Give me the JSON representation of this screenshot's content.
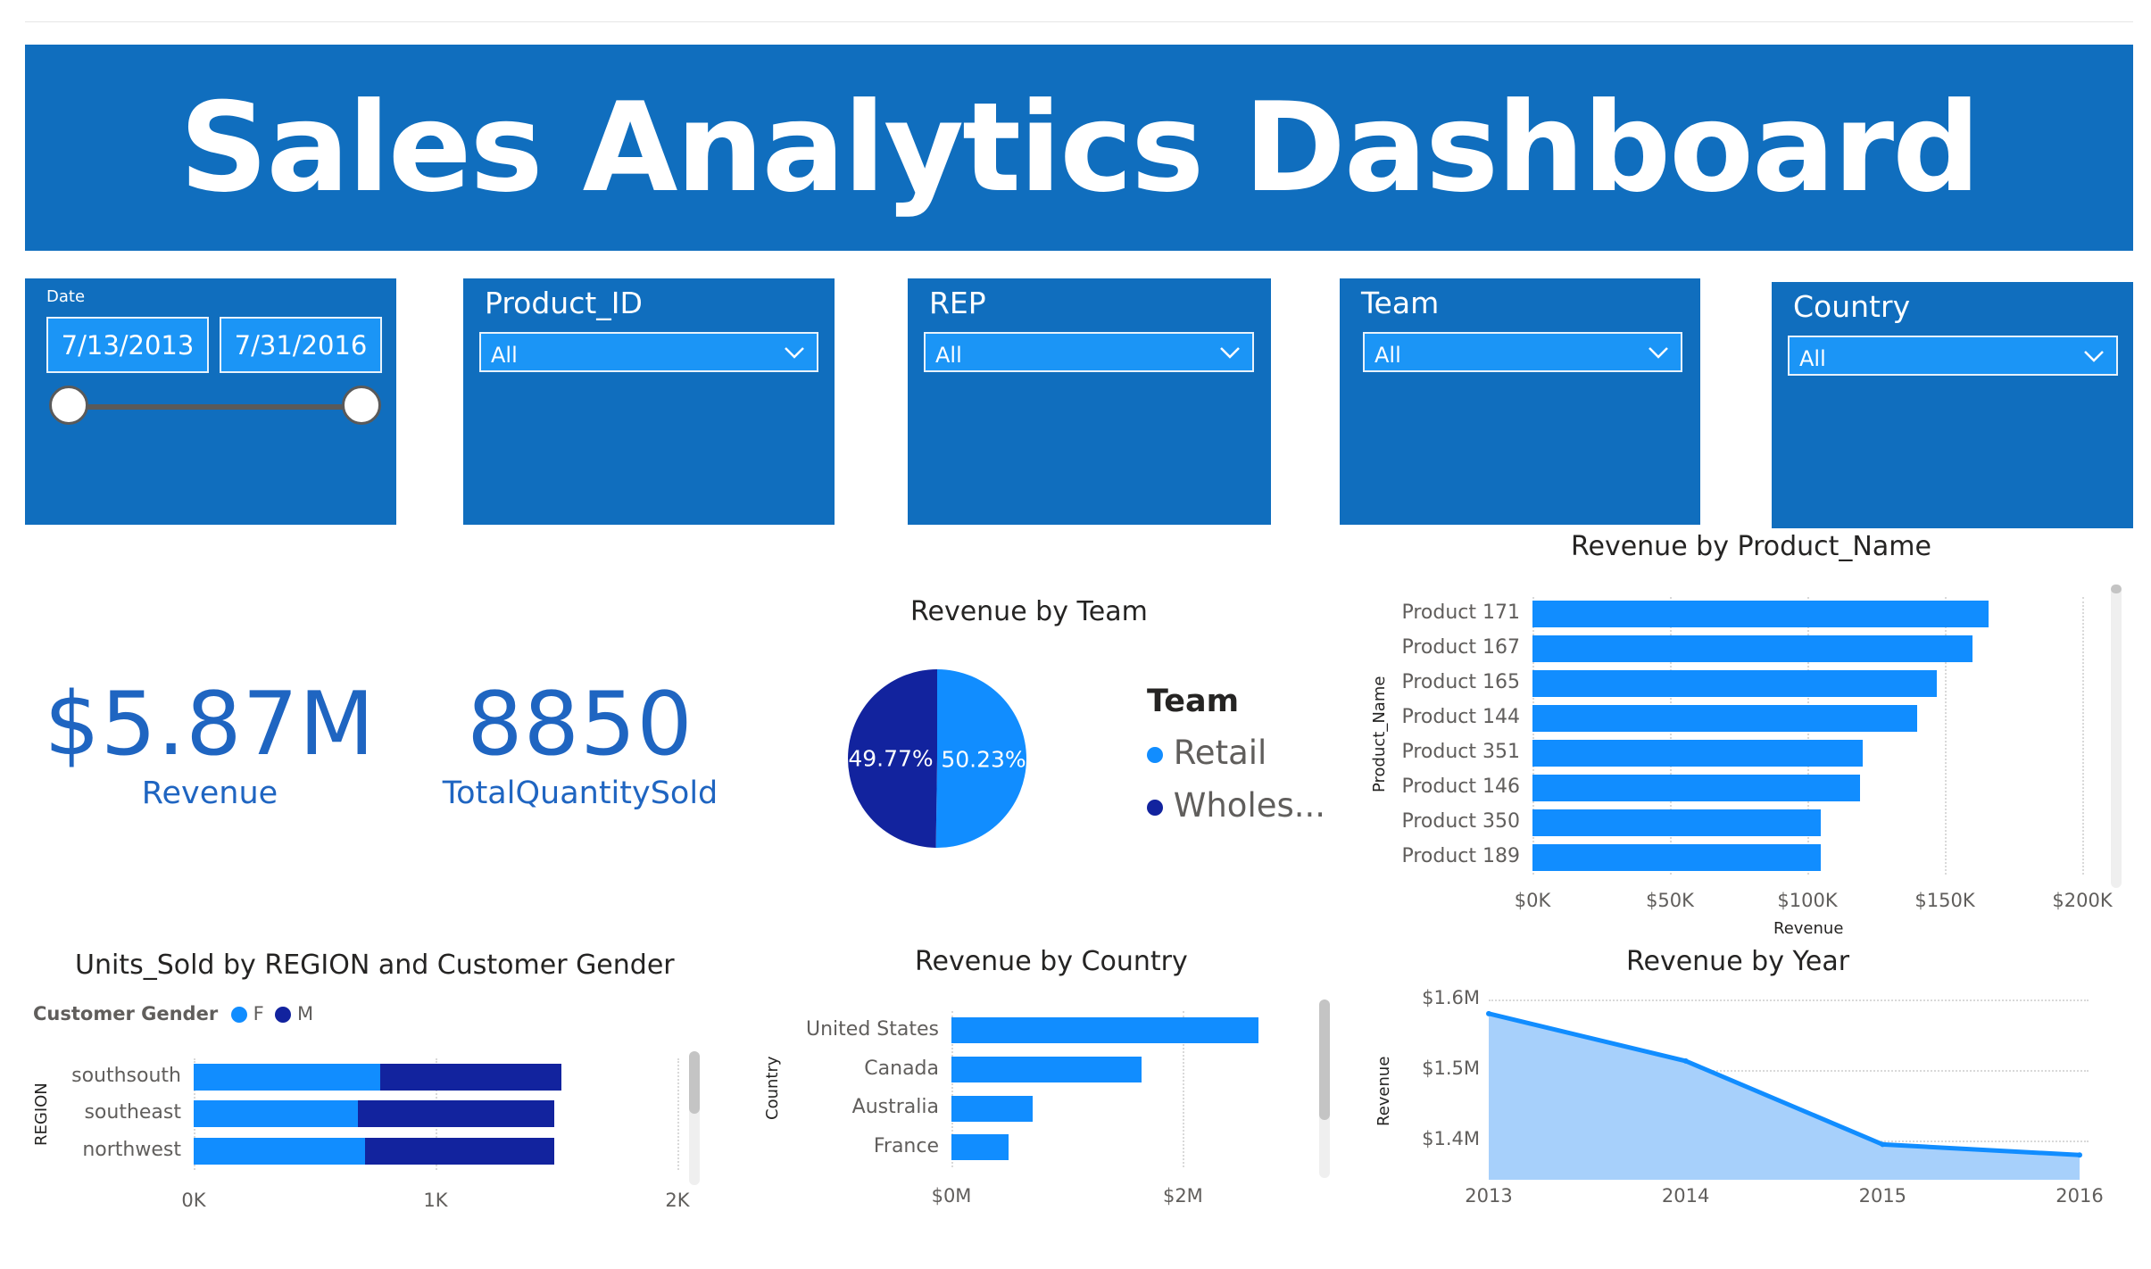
{
  "header": {
    "title": "Sales Analytics Dashboard"
  },
  "slicers": {
    "date": {
      "label": "Date",
      "start": "7/13/2013",
      "end": "7/31/2016"
    },
    "product_id": {
      "label": "Product_ID",
      "value": "All"
    },
    "rep": {
      "label": "REP",
      "value": "All"
    },
    "team": {
      "label": "Team",
      "value": "All"
    },
    "country": {
      "label": "Country",
      "value": "All"
    }
  },
  "kpis": {
    "revenue": {
      "value": "$5.87M",
      "label": "Revenue"
    },
    "quantity": {
      "value": "8850",
      "label": "TotalQuantitySold"
    }
  },
  "colors": {
    "banner": "#106ebe",
    "primary": "#118dff",
    "dark": "#12239e",
    "kpi": "#1f65c1"
  },
  "chart_data": [
    {
      "id": "revenue_by_team",
      "type": "pie",
      "title": "Revenue by Team",
      "legend_title": "Team",
      "legend_position": "right",
      "labels": [
        "Retail",
        "Wholes..."
      ],
      "values": [
        50.23,
        49.77
      ],
      "display": [
        "50.23%",
        "49.77%"
      ],
      "colors": [
        "#118dff",
        "#12239e"
      ]
    },
    {
      "id": "revenue_by_product",
      "type": "bar",
      "orientation": "horizontal",
      "title": "Revenue by Product_Name",
      "xlabel": "Revenue",
      "ylabel": "Product_Name",
      "categories": [
        "Product 171",
        "Product 167",
        "Product 165",
        "Product 144",
        "Product 351",
        "Product 146",
        "Product 350",
        "Product 189"
      ],
      "values": [
        166000,
        160000,
        147000,
        140000,
        120000,
        119000,
        105000,
        105000
      ],
      "xlim": [
        0,
        200000
      ],
      "ticks": [
        "$0K",
        "$50K",
        "$100K",
        "$150K",
        "$200K"
      ],
      "grid": true
    },
    {
      "id": "units_by_region_gender",
      "type": "bar",
      "orientation": "horizontal",
      "stacked": true,
      "title": "Units_Sold by REGION and Customer Gender",
      "legend_title": "Customer Gender",
      "legend_position": "top-left",
      "ylabel": "REGION",
      "categories": [
        "southsouth",
        "southeast",
        "northwest"
      ],
      "series": [
        {
          "name": "F",
          "values": [
            770,
            680,
            710
          ],
          "color": "#118dff"
        },
        {
          "name": "M",
          "values": [
            750,
            810,
            780
          ],
          "color": "#12239e"
        }
      ],
      "xlim": [
        0,
        2000
      ],
      "ticks": [
        "0K",
        "1K",
        "2K"
      ],
      "grid": true
    },
    {
      "id": "revenue_by_country",
      "type": "bar",
      "orientation": "horizontal",
      "title": "Revenue by Country",
      "ylabel": "Country",
      "categories": [
        "United States",
        "Canada",
        "Australia",
        "France"
      ],
      "values": [
        2650000,
        1640000,
        700000,
        490000
      ],
      "xlim": [
        0,
        3200000
      ],
      "ticks": [
        "$0M",
        "$2M"
      ],
      "grid": true
    },
    {
      "id": "revenue_by_year",
      "type": "area",
      "title": "Revenue by Year",
      "ylabel": "Revenue",
      "x": [
        "2013",
        "2014",
        "2015",
        "2016"
      ],
      "values": [
        1580000,
        1513000,
        1395000,
        1380000
      ],
      "ylim": [
        1345000,
        1600000
      ],
      "yticks": [
        "$1.6M",
        "$1.5M",
        "$1.4M"
      ],
      "grid": true
    }
  ]
}
